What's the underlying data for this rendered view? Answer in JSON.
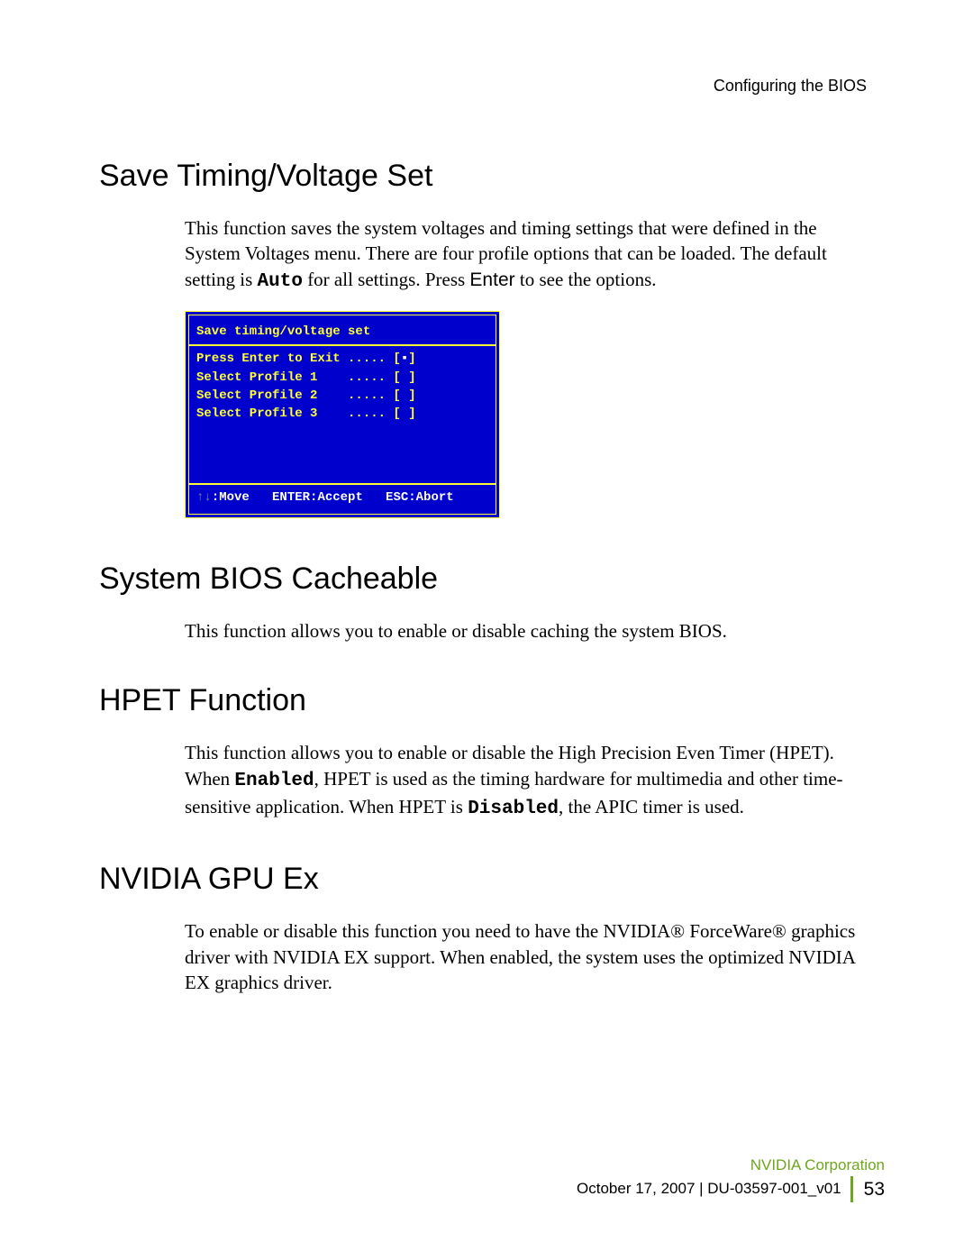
{
  "header": {
    "section_label": "Configuring the BIOS"
  },
  "sec1": {
    "title": "Save Timing/Voltage Set",
    "para": "This function saves the system voltages and timing settings that were defined in the System Voltages menu. There are four profile options that can be loaded. The default setting is ",
    "auto": "Auto",
    "para_tail": " for all settings. Press ",
    "enter": "Enter",
    "para_end": " to see the options."
  },
  "bios": {
    "title": "Save timing/voltage set",
    "l1a": "Press Enter to Exit ..... [",
    "l1b": "▪",
    "l1c": "]",
    "l2": "Select Profile 1    ..... [ ]",
    "l3": "Select Profile 2    ..... [ ]",
    "l4": "Select Profile 3    ..... [ ]",
    "foot_a": ":Move   ",
    "foot_arrows": "↑↓",
    "foot_b": "ENTER:Accept   ESC:Abort"
  },
  "sec2": {
    "title": "System BIOS Cacheable",
    "para": "This function allows you to enable or disable caching the system BIOS."
  },
  "sec3": {
    "title": "HPET Function",
    "para1": "This function allows you to enable or disable the High Precision Even Timer (HPET). When ",
    "enabled": "Enabled",
    "para2": ", HPET is used as the timing hardware for multimedia and other time-sensitive application. When HPET is ",
    "disabled": "Disabled",
    "para3": ", the APIC timer is used."
  },
  "sec4": {
    "title": "NVIDIA GPU Ex",
    "para": "To enable or disable this function you need to have the NVIDIA® ForceWare® graphics driver with NVIDIA EX support. When enabled, the system uses the optimized NVIDIA EX graphics driver."
  },
  "footer": {
    "corp": "NVIDIA Corporation",
    "date": "October 17, 2007  |  DU-03597-001_v01",
    "page": "53"
  }
}
